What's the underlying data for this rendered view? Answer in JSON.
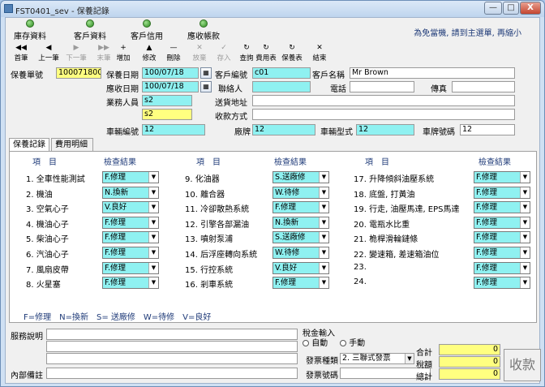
{
  "window": {
    "title": "FST0401_sev - 保養記錄",
    "min": "—",
    "max": "□",
    "close": "X"
  },
  "nav": {
    "items": [
      "庫存資料",
      "客戶資料",
      "客戶信用",
      "應收帳款"
    ],
    "hint": "為免當機, 請到主選單, 再縮小"
  },
  "toolbar": [
    {
      "icon": "◀◀",
      "label": "首筆",
      "enabled": true
    },
    {
      "icon": "◀",
      "label": "上一筆",
      "enabled": true
    },
    {
      "icon": "▶",
      "label": "下一筆",
      "enabled": false
    },
    {
      "icon": "▶▶",
      "label": "末筆",
      "enabled": false
    },
    {
      "icon": "+",
      "label": "增加",
      "enabled": true
    },
    {
      "icon": "▲",
      "label": "修改",
      "enabled": true
    },
    {
      "icon": "—",
      "label": "刪除",
      "enabled": true
    },
    {
      "icon": "✕",
      "label": "放棄",
      "enabled": false
    },
    {
      "icon": "✓",
      "label": "存入",
      "enabled": false
    },
    {
      "icon": "↻",
      "label": "查詢",
      "enabled": true
    },
    {
      "icon": "↻",
      "label": "費用表",
      "enabled": true
    },
    {
      "icon": "↻",
      "label": "保養表",
      "enabled": true
    },
    {
      "icon": "✕",
      "label": "結束",
      "enabled": true
    }
  ],
  "header": {
    "order_no_label": "保養單號",
    "order_no": "1000718002",
    "service_date_label": "保養日期",
    "service_date": "100/07/18",
    "receipt_date_label": "應收日期",
    "receipt_date": "100/07/18",
    "salesperson_label": "業務人員",
    "salesperson_code": "s2",
    "salesperson_name": "s2",
    "customer_code_label": "客戶編號",
    "customer_code": "c01",
    "customer_name_label": "客戶名稱",
    "customer_name": "Mr Brown",
    "contact_label": "聯絡人",
    "contact": "",
    "phone_label": "電話",
    "phone": "",
    "fax_label": "傳真",
    "fax": "",
    "address_label": "送貨地址",
    "address": "",
    "payment_label": "收款方式",
    "payment": "",
    "vehicle_no_label": "車輛編號",
    "vehicle_no": "12",
    "brand_label": "廠牌",
    "brand": "12",
    "model_label": "車輛型式",
    "model": "12",
    "plate_label": "車牌號碼",
    "plate": "12"
  },
  "tabs": [
    "保養記錄",
    "費用明細"
  ],
  "checklist": {
    "col_item": "項　目",
    "col_result": "檢查結果",
    "items": [
      {
        "label": "1. 全車性能測試",
        "value": "F.修理"
      },
      {
        "label": "2. 機油",
        "value": "N.換新"
      },
      {
        "label": "3. 空氣心子",
        "value": "V.良好"
      },
      {
        "label": "4. 機油心子",
        "value": "F.修理"
      },
      {
        "label": "5. 柴油心子",
        "value": "F.修理"
      },
      {
        "label": "6. 汽油心子",
        "value": "F.修理"
      },
      {
        "label": "7. 風扇皮帶",
        "value": "F.修理"
      },
      {
        "label": "8. 火星塞",
        "value": "F.修理"
      },
      {
        "label": "9. 化油器",
        "value": "S.送廠修"
      },
      {
        "label": "10. 離合器",
        "value": "W.待修"
      },
      {
        "label": "11. 冷卻散熱系統",
        "value": "F.修理"
      },
      {
        "label": "12. 引擎各部漏油",
        "value": "N.換新"
      },
      {
        "label": "13. 噴射泵浦",
        "value": "S.送廠修"
      },
      {
        "label": "14. 后浮座轉向系統",
        "value": "W.待修"
      },
      {
        "label": "15. 行控系統",
        "value": "V.良好"
      },
      {
        "label": "16. 剎車系統",
        "value": "F.修理"
      },
      {
        "label": "17. 升降傾斜油壓系統",
        "value": "F.修理"
      },
      {
        "label": "18. 底盤, 打黃油",
        "value": "F.修理"
      },
      {
        "label": "19. 行走, 油壓馬達, EPS馬達",
        "value": "F.修理"
      },
      {
        "label": "20. 電瓶水比重",
        "value": "F.修理"
      },
      {
        "label": "21. 桅桿滑輪鏈條",
        "value": "F.修理"
      },
      {
        "label": "22. 變速箱, 差速箱油位",
        "value": "F.修理"
      },
      {
        "label": "23.",
        "value": "F.修理"
      },
      {
        "label": "24.",
        "value": "F.修理"
      }
    ]
  },
  "legend": "F=修理　N=換新　S= 送廠修　W=待修　V=良好",
  "footer": {
    "service_desc_label": "服務說明",
    "internal_note_label": "內部備註",
    "tax_label": "稅金輸入",
    "tax_auto": "自動",
    "tax_manual": "手動",
    "invoice_type_label": "發票種類",
    "invoice_type": "2. 三聯式發票",
    "invoice_no_label": "發票號碼",
    "invoice_no": "",
    "subtotal_label": "合計",
    "subtotal": "0",
    "tax_amount_label": "稅額",
    "tax_amount": "0",
    "total_label": "總計",
    "total": "0",
    "collect_label": "收款"
  }
}
